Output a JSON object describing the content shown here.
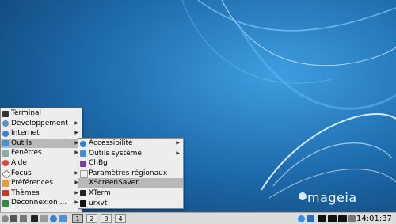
{
  "desktop": {
    "brand": "mageia",
    "bg_color": "#1f6fb0"
  },
  "main_menu": {
    "items": [
      {
        "label": "Terminal",
        "icon": "terminal-icon",
        "submenu": false
      },
      {
        "label": "Développement",
        "icon": "development-icon",
        "submenu": true
      },
      {
        "label": "Internet",
        "icon": "internet-icon",
        "submenu": true
      },
      {
        "label": "Outils",
        "icon": "tools-icon",
        "submenu": true,
        "selected": true
      },
      {
        "label": "Fenêtres",
        "icon": "windows-icon",
        "submenu": true
      },
      {
        "label": "Aide",
        "icon": "help-icon",
        "submenu": false
      },
      {
        "label": "Focus",
        "icon": "focus-icon",
        "submenu": true
      },
      {
        "label": "Préférences",
        "icon": "preferences-icon",
        "submenu": true
      },
      {
        "label": "Thèmes",
        "icon": "themes-icon",
        "submenu": true
      },
      {
        "label": "Déconnexion ...",
        "icon": "logout-icon",
        "submenu": true
      }
    ]
  },
  "sub_menu": {
    "items": [
      {
        "label": "Accessibilité",
        "icon": "accessibility-icon",
        "submenu": true
      },
      {
        "label": "Outils système",
        "icon": "system-tools-icon",
        "submenu": true
      },
      {
        "label": "ChBg",
        "icon": "chbg-icon",
        "submenu": false
      },
      {
        "label": "Paramètres régionaux",
        "icon": "locale-icon",
        "submenu": false
      },
      {
        "label": "XScreenSaver",
        "icon": "xscreensaver-icon",
        "submenu": false,
        "selected": true
      },
      {
        "label": "XTerm",
        "icon": "xterm-icon",
        "submenu": false
      },
      {
        "label": "urxvt",
        "icon": "urxvt-icon",
        "submenu": false
      }
    ]
  },
  "taskbar": {
    "workspaces": [
      "1",
      "2",
      "3",
      "4"
    ],
    "active_workspace": "1",
    "clock": "14:01:37"
  }
}
